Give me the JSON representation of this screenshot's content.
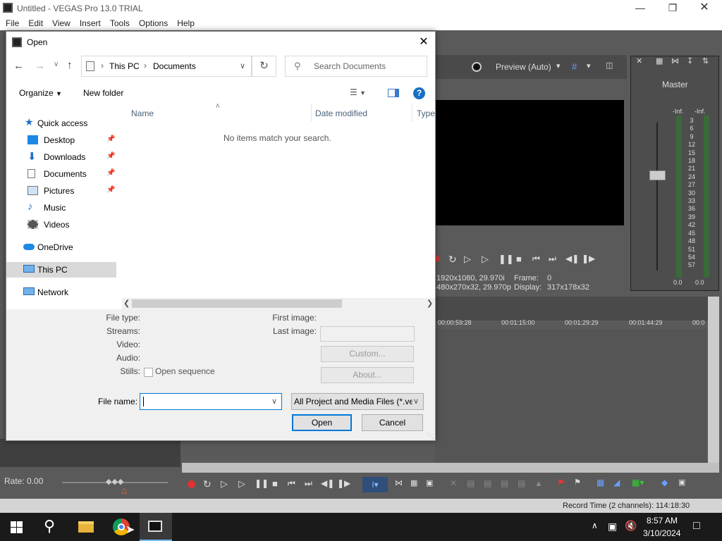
{
  "app": {
    "title": "Untitled - VEGAS Pro 13.0 TRIAL",
    "menu": [
      "File",
      "Edit",
      "View",
      "Insert",
      "Tools",
      "Options",
      "Help"
    ],
    "preview_label": "Preview (Auto)",
    "master_label": "Master",
    "meter_top": [
      "-Inf.",
      "-Inf."
    ],
    "meter_ticks": [
      "3",
      "6",
      "9",
      "12",
      "15",
      "18",
      "21",
      "24",
      "27",
      "30",
      "33",
      "36",
      "39",
      "42",
      "45",
      "48",
      "51",
      "54",
      "57"
    ],
    "meter_bottom": [
      "0.0",
      "0.0"
    ],
    "preview_info": {
      "project": "1920x1080, 29.970i",
      "preview": "480x270x32, 29.970p",
      "frame_label": "Frame:",
      "frame_value": "0",
      "display_label": "Display:",
      "display_value": "317x178x32"
    },
    "timecodes": [
      "00:00:59:28",
      "00:01:15:00",
      "00:01:29:29",
      "00:01:44:29",
      "00:0"
    ],
    "rate": "Rate: 0.00",
    "status": "Record Time (2 channels): 114:18:30"
  },
  "dialog": {
    "title": "Open",
    "breadcrumb": [
      "This PC",
      "Documents"
    ],
    "search_placeholder": "Search Documents",
    "organize": "Organize",
    "new_folder": "New folder",
    "columns": [
      "Name",
      "Date modified",
      "Type"
    ],
    "empty_message": "No items match your search.",
    "nav": {
      "quick_access": "Quick access",
      "items": [
        {
          "label": "Desktop",
          "pinned": true
        },
        {
          "label": "Downloads",
          "pinned": true
        },
        {
          "label": "Documents",
          "pinned": true
        },
        {
          "label": "Pictures",
          "pinned": true
        },
        {
          "label": "Music",
          "pinned": false
        },
        {
          "label": "Videos",
          "pinned": false
        }
      ],
      "onedrive": "OneDrive",
      "this_pc": "This PC",
      "network": "Network"
    },
    "info": {
      "file_type": "File type:",
      "streams": "Streams:",
      "video": "Video:",
      "audio": "Audio:",
      "stills": "Stills:",
      "open_sequence": "Open sequence",
      "first_image": "First image:",
      "last_image": "Last image:",
      "custom": "Custom...",
      "about": "About..."
    },
    "file_name_label": "File name:",
    "file_name_value": "",
    "filter": "All Project and Media Files (*.ve",
    "open": "Open",
    "cancel": "Cancel"
  },
  "taskbar": {
    "time": "8:57 AM",
    "date": "3/10/2024"
  },
  "colors": {
    "accent": "#0078d7",
    "selected": "#cce8ff",
    "dialog_bg": "#f0f0f0",
    "taskbar": "#1a1a1a"
  }
}
